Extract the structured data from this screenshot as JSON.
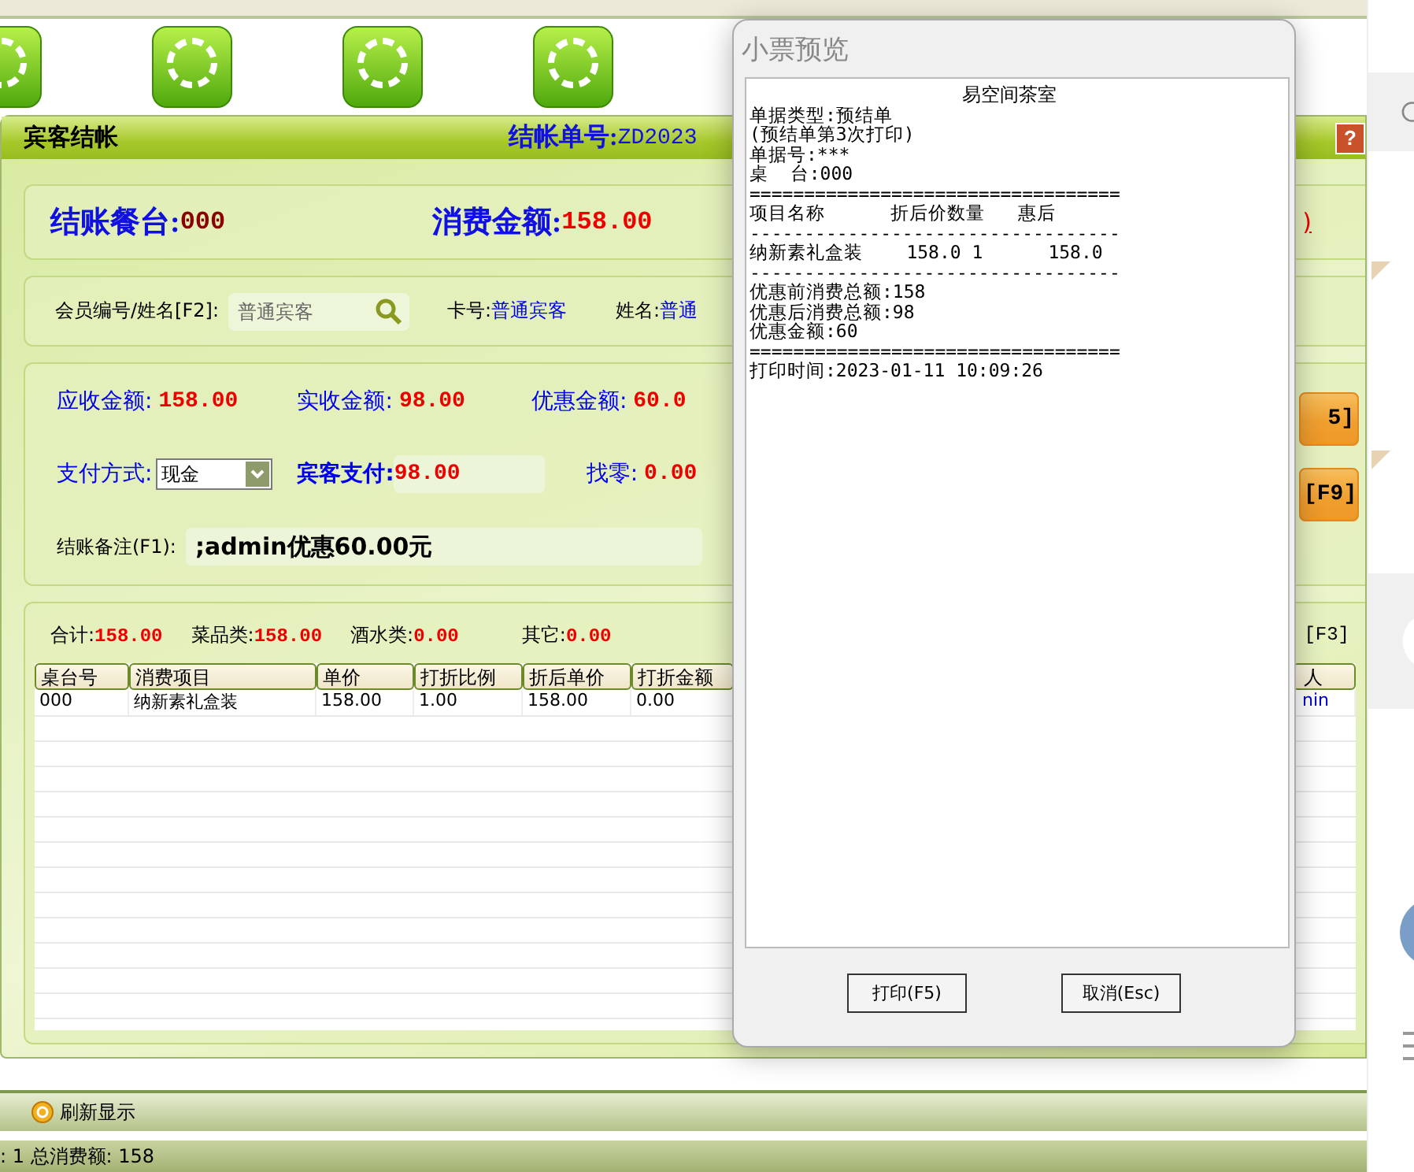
{
  "window": {
    "title": "宾客结帐",
    "bill_no_label": "结帐单号:",
    "bill_no": "ZD2023",
    "help_button": "?"
  },
  "summary": {
    "table_label": "结账餐台:",
    "table_value": "000",
    "amount_label": "消费金额:",
    "amount_value": "158.00",
    "link": ")"
  },
  "member": {
    "label": "会员编号/姓名[F2]:",
    "placeholder": "普通宾客",
    "card_label": "卡号:",
    "card_value": "普通宾客",
    "name_label": "姓名:",
    "name_value": "普通"
  },
  "payment": {
    "amounts": [
      {
        "label": "应收金额:",
        "value": "158.00"
      },
      {
        "label": "实收金额:",
        "value": "98.00"
      },
      {
        "label": "优惠金额:",
        "value": "60.0"
      }
    ],
    "method_label": "支付方式:",
    "method": "现金",
    "guest_pay_label": "宾客支付:",
    "guest_pay": "98.00",
    "change_label": "找零:",
    "change": "0.00",
    "note_label": "结账备注(F1):",
    "note": ";admin优惠60.00元"
  },
  "action_buttons": [
    "5]",
    "[F9]"
  ],
  "totals": [
    {
      "label": "合计:",
      "value": "158.00"
    },
    {
      "label": "菜品类:",
      "value": "158.00"
    },
    {
      "label": "酒水类:",
      "value": "0.00"
    },
    {
      "label": "其它:",
      "value": "0.00"
    }
  ],
  "totals_hint": "[F3]",
  "table": {
    "columns": [
      "桌台号",
      "消费项目",
      "单价",
      "打折比例",
      "折后单价",
      "打折金额"
    ],
    "right_columns": [
      "人"
    ],
    "rows": [
      {
        "cells": [
          "000",
          "纳新素礼盒装",
          "158.00",
          "1.00",
          "158.00",
          "0.00"
        ],
        "right_cells": [
          "nin"
        ]
      }
    ]
  },
  "toolbar": {
    "refresh": "刷新显示"
  },
  "status_bar": ": 1 总消费额: 158",
  "dialog": {
    "title": "小票预览",
    "shop_name": "易空间茶室",
    "receipt_lines": [
      "单据类型:预结单",
      "(预结单第3次打印)",
      "单据号:***",
      "桌  台:000",
      "==================================",
      "项目名称      折后价数量   惠后",
      "----------------------------------",
      "纳新素礼盒装    158.0 1      158.0",
      "----------------------------------",
      "优惠前消费总额:158",
      "优惠后消费总额:98",
      "优惠金额:60",
      "==================================",
      "打印时间:2023-01-11 10:09:26"
    ],
    "buttons": [
      "打印(F5)",
      "取消(Esc)"
    ]
  }
}
